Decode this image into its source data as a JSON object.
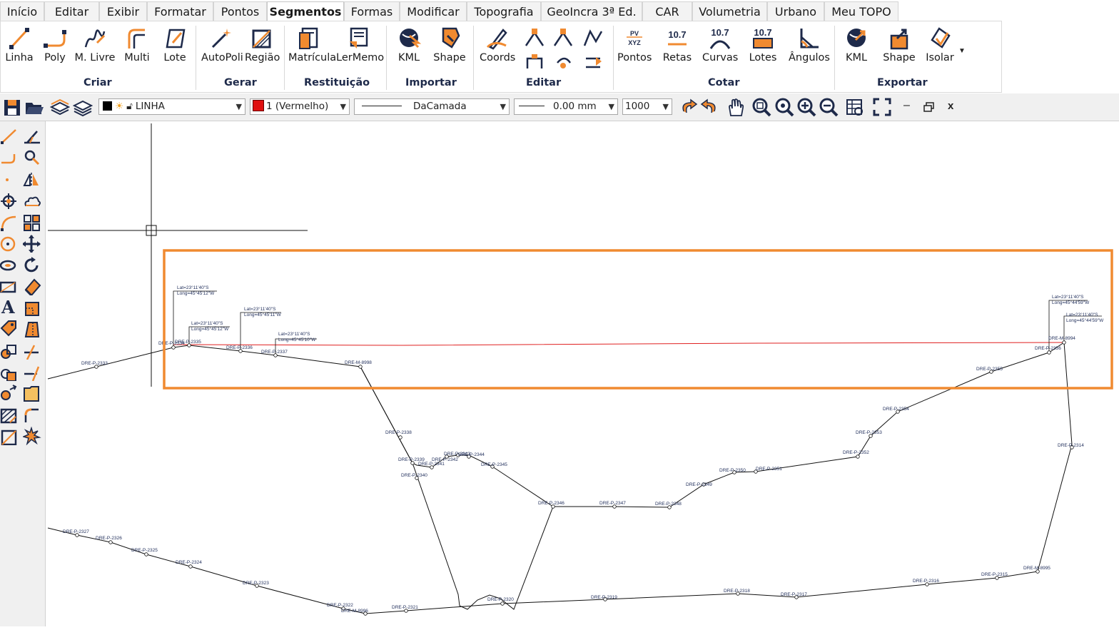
{
  "menu": {
    "tabs": [
      "Início",
      "Editar",
      "Exibir",
      "Formatar",
      "Pontos",
      "Segmentos",
      "Formas",
      "Modificar",
      "Topografia",
      "GeoIncra 3ª Ed.",
      "CAR",
      "Volumetria",
      "Urbano",
      "Meu TOPO"
    ],
    "active": "Segmentos"
  },
  "ribbon": {
    "buttons": [
      "Linha",
      "Poly",
      "M. Livre",
      "Multi",
      "Lote",
      "AutoPoli",
      "Região",
      "Matrícula",
      "LerMemo",
      "KML",
      "Shape",
      "Coords",
      "Pontos",
      "Retas",
      "Curvas",
      "Lotes",
      "Ângulos",
      "KML",
      "Shape",
      "Isolar"
    ],
    "groups": [
      "Criar",
      "Gerar",
      "Restituição",
      "Importar",
      "Editar",
      "Cotar",
      "Exportar"
    ],
    "value_icon_text": "10.7",
    "pv_icon_text": "PV",
    "xyz_icon_text": "XYZ"
  },
  "toolbar": {
    "layer": "LINHA",
    "color": "1 (Vermelho)",
    "linetype": "DaCamada",
    "lineweight": "0.00 mm",
    "scale": "1000"
  },
  "drawing": {
    "point_labels": [
      "DRE-P-2333",
      "DRE-P-2335",
      "DRE-P-2336",
      "DRE-P-2337",
      "DRE-M-8998",
      "DRE-P-2338",
      "DRE-P-2339",
      "DRE-P-2340",
      "DRE-P-2341",
      "DRE-P-2342",
      "DRE-P-2343",
      "DRE-P-2344",
      "DRE-P-2345",
      "DRE-P-2346",
      "DRE-P-2347",
      "DRE-P-2348",
      "DRE-P-2349",
      "DRE-P-2350",
      "DRE-P-2351",
      "DRE-P-2352",
      "DRE-P-2353",
      "DRE-P-2354",
      "DRE-P-2355",
      "DRE-P-2356",
      "DRE-M-8994",
      "DRE-P-2314",
      "DRE-M-8995",
      "DRE-P-2315",
      "DRE-P-2316",
      "DRE-P-2317",
      "DRE-P-2318",
      "DRE-P-2319",
      "DRE-P-2320",
      "DRE-P-2321",
      "DRE-M-8996",
      "DRE-P-2322",
      "DRE-P-2323",
      "DRE-P-2324",
      "DRE-P-2325",
      "DRE-P-2326",
      "DRE-P-2327",
      "DRE-P-2334"
    ],
    "coord_labels": [
      {
        "lat": "Lat=23°11'40\"S",
        "long": "Long=45°45'12\"W"
      },
      {
        "lat": "Lat=23°11'40\"S",
        "long": "Long=45°45'12\"W"
      },
      {
        "lat": "Lat=23°11'40\"S",
        "long": "Long=45°45'11\"W"
      },
      {
        "lat": "Lat=23°11'40\"S",
        "long": "Long=45°45'10\"W"
      },
      {
        "lat": "Lat=23°11'40\"S",
        "long": "Long=45°44'59\"W"
      },
      {
        "lat": "Lat=23°11'40\"S",
        "long": "Long=45°44'59\"W"
      }
    ],
    "highlight_color": "#f08a30",
    "red_line_color": "#e02020"
  }
}
